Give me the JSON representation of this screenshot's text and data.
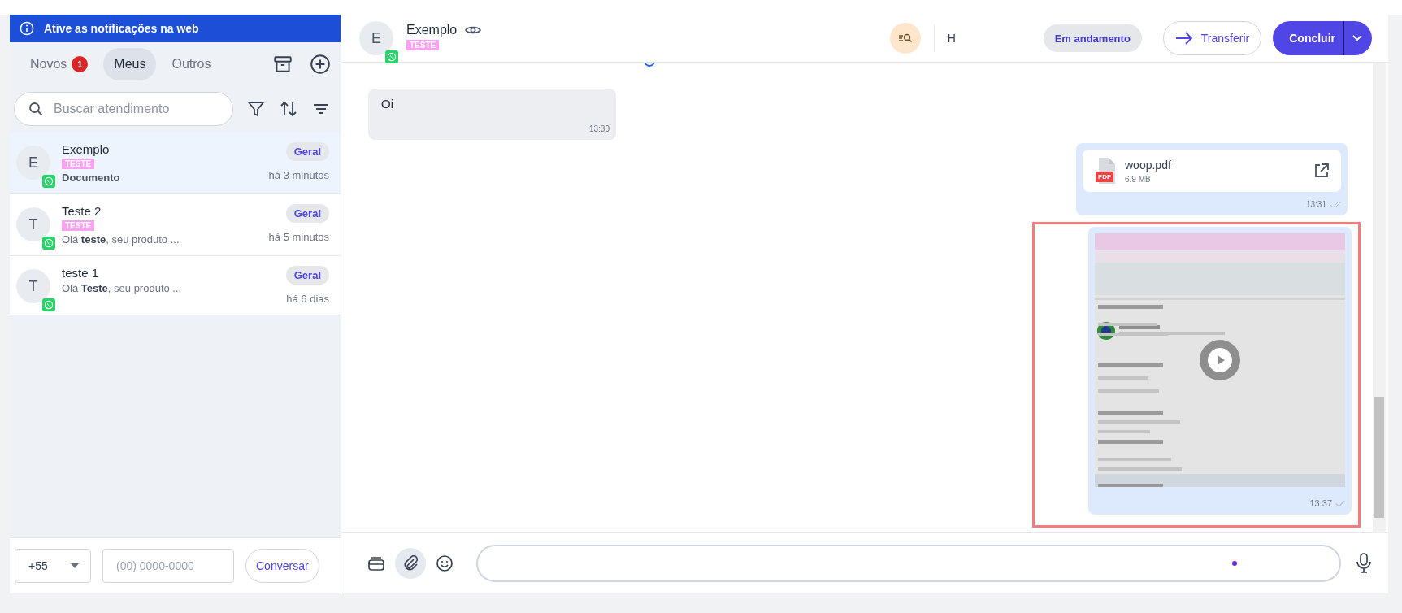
{
  "notification_banner": {
    "text": "Ative as notificações na web"
  },
  "tabs": [
    {
      "label": "Novos",
      "badge": "1",
      "selected": false
    },
    {
      "label": "Meus",
      "selected": true
    },
    {
      "label": "Outros",
      "selected": false
    }
  ],
  "search": {
    "placeholder": "Buscar atendimento"
  },
  "conversations": [
    {
      "initial": "E",
      "name": "Exemplo",
      "tag": "TESTE",
      "preview": "Documento",
      "preview_bold": true,
      "queue": "Geral",
      "time": "há 3 minutos",
      "selected": true
    },
    {
      "initial": "T",
      "name": "Teste 2",
      "tag": "TESTE",
      "preview": "Olá **teste**, seu produto ...",
      "preview_bold": false,
      "queue": "Geral",
      "time": "há 5 minutos",
      "selected": false
    },
    {
      "initial": "T",
      "name": "teste 1",
      "preview": "Olá **Teste**, seu produto ...",
      "preview_bold": false,
      "queue": "Geral",
      "time": "há 6 dias",
      "selected": false
    }
  ],
  "new_chat": {
    "country_code": "+55",
    "phone_placeholder": "(00) 0000-0000",
    "button": "Conversar"
  },
  "chat_header": {
    "initial": "E",
    "name": "Exemplo",
    "tag": "TESTE",
    "field_text": "H",
    "status": "Em andamento",
    "transfer": "Transferir",
    "conclude": "Concluir"
  },
  "messages": [
    {
      "kind": "text",
      "outgoing": false,
      "text": "Oi",
      "time": "13:30"
    },
    {
      "kind": "file",
      "outgoing": true,
      "file_name": "woop.pdf",
      "file_size": "6.9 MB",
      "file_type": "PDF",
      "time": "13:31",
      "delivered": true
    },
    {
      "kind": "video",
      "outgoing": true,
      "time": "13:37",
      "delivered": false,
      "highlighted": true
    }
  ]
}
